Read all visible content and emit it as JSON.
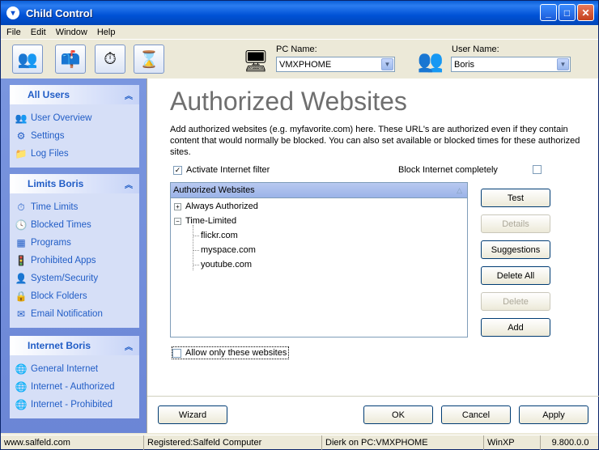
{
  "window": {
    "title": "Child Control"
  },
  "menu": [
    "File",
    "Edit",
    "Window",
    "Help"
  ],
  "toolbar": {
    "pc_label": "PC Name:",
    "pc_value": "VMXPHOME",
    "user_label": "User Name:",
    "user_value": "Boris"
  },
  "sidebar": {
    "all_users": {
      "title": "All Users",
      "items": [
        "User Overview",
        "Settings",
        "Log Files"
      ]
    },
    "limits": {
      "title": "Limits Boris",
      "items": [
        "Time Limits",
        "Blocked Times",
        "Programs",
        "Prohibited Apps",
        "System/Security",
        "Block Folders",
        "Email Notification"
      ]
    },
    "internet": {
      "title": "Internet Boris",
      "items": [
        "General Internet",
        "Internet - Authorized",
        "Internet - Prohibited"
      ]
    }
  },
  "main": {
    "title": "Authorized Websites",
    "description": "Add authorized websites (e.g. myfavorite.com) here. These URL's are authorized even if they contain content that would normally be blocked. You can also set available or blocked times for these authorized sites.",
    "activate_filter_label": "Activate Internet filter",
    "block_completely_label": "Block Internet completely",
    "list_header": "Authorized Websites",
    "tree": {
      "always": "Always Authorized",
      "time_limited": "Time-Limited",
      "sites": [
        "flickr.com",
        "myspace.com",
        "youtube.com"
      ]
    },
    "allow_only_label": "Allow only these websites",
    "buttons": {
      "test": "Test",
      "details": "Details",
      "suggestions": "Suggestions",
      "delete_all": "Delete All",
      "delete": "Delete",
      "add": "Add"
    }
  },
  "footer": {
    "wizard": "Wizard",
    "ok": "OK",
    "cancel": "Cancel",
    "apply": "Apply"
  },
  "statusbar": {
    "url": "www.salfeld.com",
    "registered": "Registered:Salfeld Computer",
    "session": "Dierk on PC:VMXPHOME",
    "os": "WinXP",
    "version": "9.800.0.0"
  }
}
